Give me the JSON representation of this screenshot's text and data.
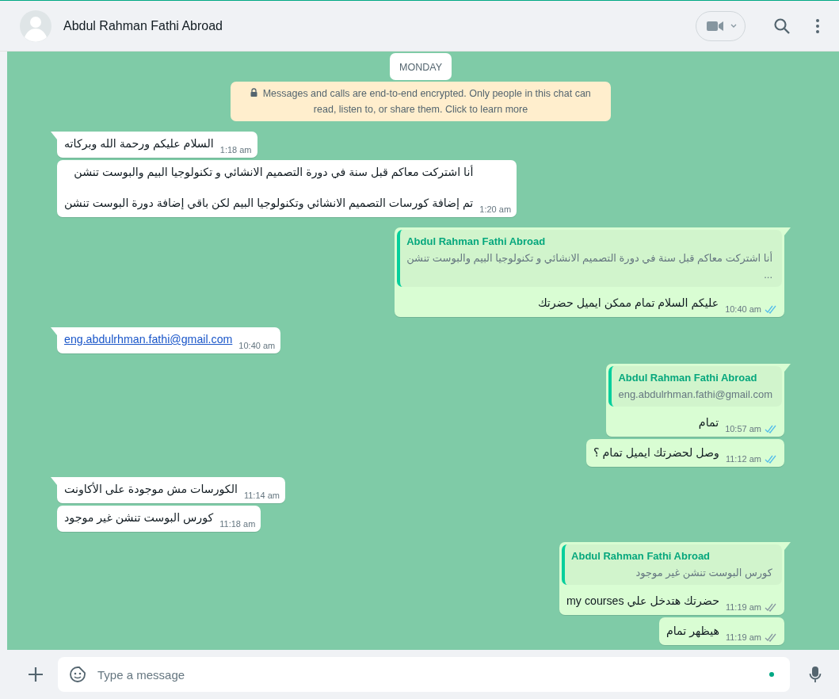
{
  "header": {
    "contact_name": "Abdul Rahman Fathi Abroad"
  },
  "date_chip": "MONDAY",
  "encryption_notice": "Messages and calls are end-to-end encrypted. Only people in this chat can read, listen to, or share them. Click to learn more",
  "messages": [
    {
      "kind": "text",
      "outgoing": false,
      "tail": true,
      "paragraphs": [
        "السلام عليكم ورحمة الله وبركاته"
      ],
      "time": "1:18 am"
    },
    {
      "kind": "text",
      "outgoing": false,
      "tail": false,
      "paragraphs": [
        "أنا اشتركت معاكم قبل سنة في دورة التصميم الانشائي و تكنولوجيا البيم والبوست تنشن",
        "تم إضافة كورسات التصميم الانشائي وتكنولوجيا البيم لكن باقي إضافة دورة البوست تنشن"
      ],
      "time": "1:20 am"
    },
    {
      "kind": "text",
      "outgoing": true,
      "tail": true,
      "reply": {
        "author": "Abdul Rahman Fathi Abroad",
        "lines": [
          "أنا اشتركت معاكم قبل سنة في دورة التصميم الانشائي و تكنولوجيا البيم والبوست تنشن",
          "..."
        ]
      },
      "paragraphs": [
        "عليكم السلام تمام ممكن ايميل حضرتك"
      ],
      "time": "10:40 am",
      "read": true
    },
    {
      "kind": "link",
      "outgoing": false,
      "tail": true,
      "paragraphs": [
        "eng.abdulrhman.fathi@gmail.com"
      ],
      "time": "10:40 am"
    },
    {
      "kind": "text",
      "outgoing": true,
      "tail": true,
      "reply": {
        "author": "Abdul Rahman Fathi Abroad",
        "lines": [
          "eng.abdulrhman.fathi@gmail.com"
        ]
      },
      "paragraphs": [
        "تمام"
      ],
      "time": "10:57 am",
      "read": true
    },
    {
      "kind": "text",
      "outgoing": true,
      "tail": false,
      "paragraphs": [
        "وصل لحضرتك ايميل تمام ؟"
      ],
      "time": "11:12 am",
      "read": true
    },
    {
      "kind": "text",
      "outgoing": false,
      "tail": true,
      "paragraphs": [
        "الكورسات مش موجودة على الأكاونت"
      ],
      "time": "11:14 am"
    },
    {
      "kind": "text",
      "outgoing": false,
      "tail": false,
      "paragraphs": [
        "كورس البوست تنشن غير موجود"
      ],
      "time": "11:18 am"
    },
    {
      "kind": "text",
      "outgoing": true,
      "tail": true,
      "reply": {
        "author": "Abdul Rahman Fathi Abroad",
        "lines": [
          "كورس البوست تنشن غير موجود"
        ]
      },
      "paragraphs": [
        "حضرتك هتدخل علي my courses"
      ],
      "time": "11:19 am",
      "read": false
    },
    {
      "kind": "text",
      "outgoing": true,
      "tail": false,
      "paragraphs": [
        "هيظهر تمام"
      ],
      "time": "11:19 am",
      "read": false
    }
  ],
  "composer": {
    "placeholder": "Type a message"
  }
}
